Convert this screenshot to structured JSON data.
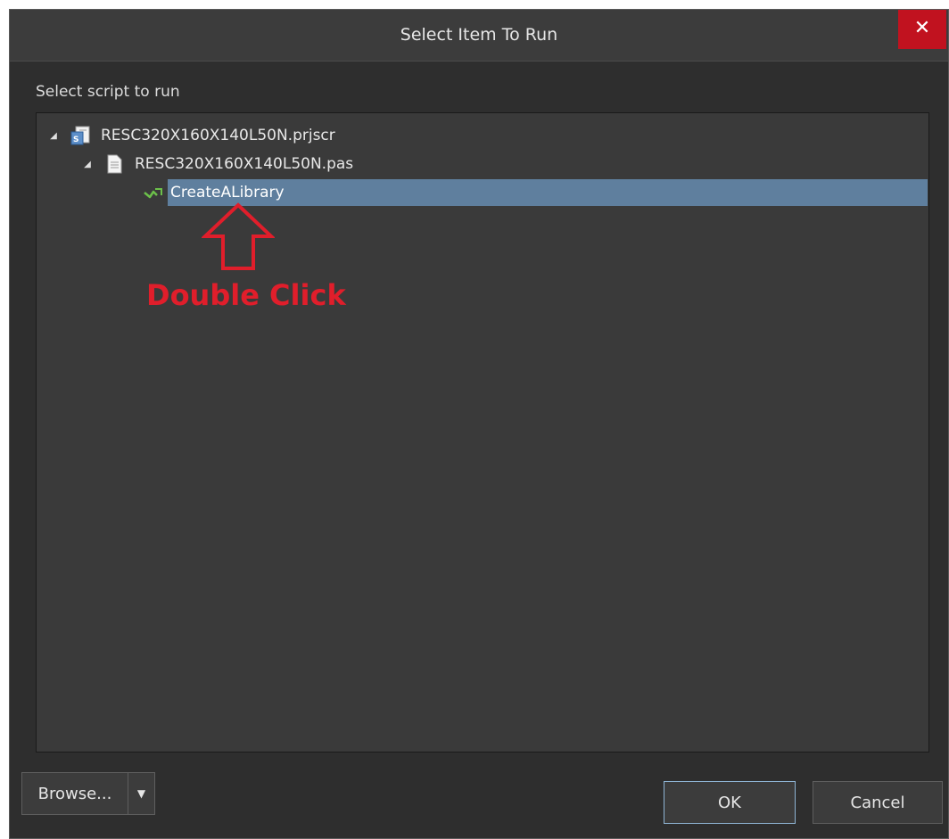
{
  "dialog": {
    "title": "Select Item To Run",
    "close_label": "✕"
  },
  "prompt": "Select script to run",
  "tree": {
    "project": {
      "label": "RESC320X160X140L50N.prjscr",
      "expander": "◢"
    },
    "file": {
      "label": "RESC320X160X140L50N.pas",
      "expander": "◢"
    },
    "procedure": {
      "label": "CreateALibrary"
    }
  },
  "annotation": {
    "text": "Double Click",
    "color": "#e01e2b"
  },
  "footer": {
    "browse_label": "Browse...",
    "browse_dropdown": "▼",
    "ok_label": "OK",
    "cancel_label": "Cancel"
  },
  "colors": {
    "dialog_bg": "#2e2e2e",
    "panel_bg": "#3a3a3a",
    "selection": "#5f7f9e",
    "close_red": "#c1121f",
    "ok_border": "#8fb4d4"
  }
}
